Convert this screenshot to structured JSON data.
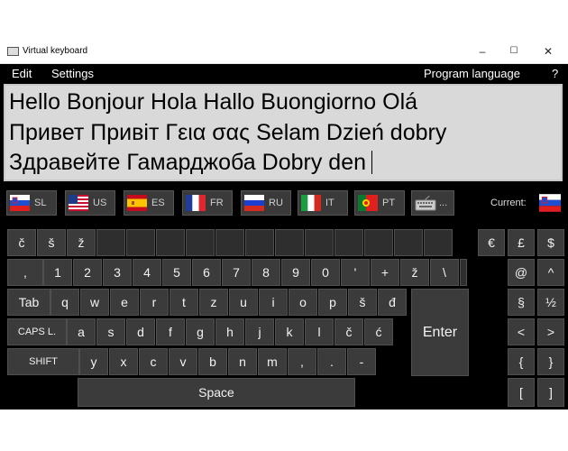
{
  "window": {
    "title": "Virtual keyboard",
    "minimize": "–",
    "maximize": "☐",
    "close": "✕"
  },
  "menu": {
    "edit": "Edit",
    "settings": "Settings",
    "program_language": "Program language",
    "help": "?"
  },
  "text": {
    "line1": "Hello Bonjour Hola Hallo Buongiorno Olá",
    "line2": "Привет Привіт Γεια σας Selam Dzień dobry",
    "line3": "Здравейте Гамарджоба Dobry den"
  },
  "languages": [
    {
      "code": "SL",
      "flag": "slovenia-flag-icon"
    },
    {
      "code": "US",
      "flag": "usa-flag-icon"
    },
    {
      "code": "ES",
      "flag": "spain-flag-icon"
    },
    {
      "code": "FR",
      "flag": "france-flag-icon"
    },
    {
      "code": "RU",
      "flag": "russia-flag-icon"
    },
    {
      "code": "IT",
      "flag": "italy-flag-icon"
    },
    {
      "code": "PT",
      "flag": "portugal-flag-icon"
    },
    {
      "code": "...",
      "flag": "keyboard-icon"
    }
  ],
  "current": {
    "label": "Current:",
    "flag": "slovenia-flag-icon"
  },
  "keys": {
    "row0": [
      "č",
      "š",
      "ž"
    ],
    "row1": [
      ",",
      "1",
      "2",
      "3",
      "4",
      "5",
      "6",
      "7",
      "8",
      "9",
      "0",
      "'",
      "+",
      "ž",
      "\\"
    ],
    "row2_label": "Tab",
    "row2": [
      "q",
      "w",
      "e",
      "r",
      "t",
      "z",
      "u",
      "i",
      "o",
      "p",
      "š",
      "đ"
    ],
    "row3_label": "CAPS L.",
    "row3": [
      "a",
      "s",
      "d",
      "f",
      "g",
      "h",
      "j",
      "k",
      "l",
      "č",
      "ć"
    ],
    "enter": "Enter",
    "row4_label": "SHIFT",
    "row4": [
      "y",
      "x",
      "c",
      "v",
      "b",
      "n",
      "m",
      ",",
      ".",
      "-"
    ],
    "space": "Space",
    "side": [
      "€",
      "£",
      "$",
      "@",
      "^",
      "§",
      "½",
      "<",
      ">",
      "{",
      "}",
      "[",
      "]"
    ]
  }
}
